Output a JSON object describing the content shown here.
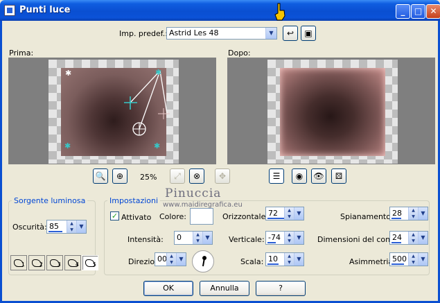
{
  "window": {
    "title": "Punti luce",
    "min": "_",
    "max": "□",
    "close": "✕"
  },
  "preset": {
    "label": "Imp. predef.:",
    "value": "Astrid Les 48"
  },
  "preview": {
    "before_label": "Prima:",
    "after_label": "Dopo:",
    "zoom": "25%"
  },
  "watermark": {
    "name": "Pinuccia",
    "url": "www.maidiregrafica.eu"
  },
  "source": {
    "title": "Sorgente luminosa",
    "darkness_label": "Oscurità:",
    "darkness_value": "85"
  },
  "settings": {
    "title": "Impostazioni",
    "enabled_label": "Attivato",
    "color_label": "Colore:",
    "intensity_label": "Intensità:",
    "intensity_value": "0",
    "direction_label": "Direzione:",
    "direction_value": "00",
    "horizontal_label": "Orizzontale:",
    "horizontal_value": "72",
    "vertical_label": "Verticale:",
    "vertical_value": "-74",
    "scale_label": "Scala:",
    "scale_value": "10",
    "flatten_label": "Spianamento:",
    "flatten_value": "28",
    "cone_label": "Dimensioni del cono:",
    "cone_value": "24",
    "asymmetry_label": "Asimmetria:",
    "asymmetry_value": "500"
  },
  "shape_buttons": [
    "1",
    "2",
    "3",
    "4",
    "5"
  ],
  "buttons": {
    "ok": "OK",
    "cancel": "Annulla",
    "help": "?"
  }
}
